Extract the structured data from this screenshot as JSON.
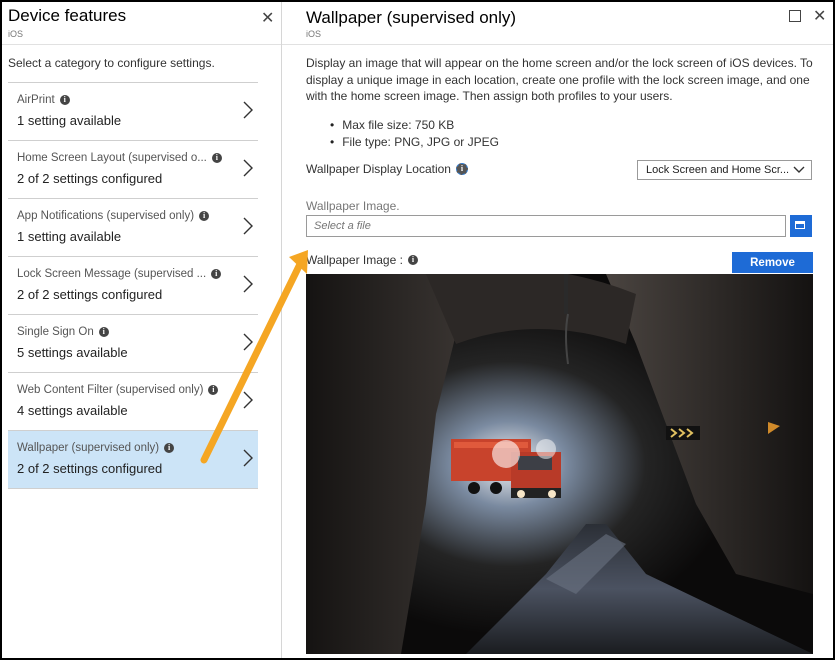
{
  "left_blade": {
    "title": "Device features",
    "subtitle": "iOS",
    "description": "Select a category to configure settings.",
    "categories": [
      {
        "name": "AirPrint",
        "status": "1 setting available",
        "selected": false
      },
      {
        "name": "Home Screen Layout (supervised o...",
        "status": "2 of 2 settings configured",
        "selected": false
      },
      {
        "name": "App Notifications (supervised only)",
        "status": "1 setting available",
        "selected": false
      },
      {
        "name": "Lock Screen Message (supervised ...",
        "status": "2 of 2 settings configured",
        "selected": false
      },
      {
        "name": "Single Sign On",
        "status": "5 settings available",
        "selected": false
      },
      {
        "name": "Web Content Filter (supervised only)",
        "status": "4 settings available",
        "selected": false
      },
      {
        "name": "Wallpaper (supervised only)",
        "status": "2 of 2 settings configured",
        "selected": true
      }
    ]
  },
  "right_blade": {
    "title": "Wallpaper (supervised only)",
    "subtitle": "iOS",
    "description": "Display an image that will appear on the home screen and/or the lock screen of iOS devices. To display a unique image in each location, create one profile with the lock screen image, and one with the home screen image. Then assign both profiles to your users.",
    "bullets": [
      "Max file size: 750 KB",
      "File type: PNG, JPG or JPEG"
    ],
    "display_location_label": "Wallpaper Display Location",
    "display_location_value": "Lock Screen and Home Scr...",
    "image_field_label": "Wallpaper Image.",
    "file_placeholder": "Select a file",
    "preview_label": "Wallpaper Image :",
    "remove_label": "Remove"
  },
  "colors": {
    "accent": "#1e6bd6",
    "selected_row": "#cce4f7",
    "annotation_arrow": "#f5a623"
  },
  "icons": {
    "close": "close-icon",
    "maximize": "maximize-icon",
    "info": "info-icon",
    "chevron": "chevron-right-icon",
    "browse": "folder-open-icon"
  }
}
